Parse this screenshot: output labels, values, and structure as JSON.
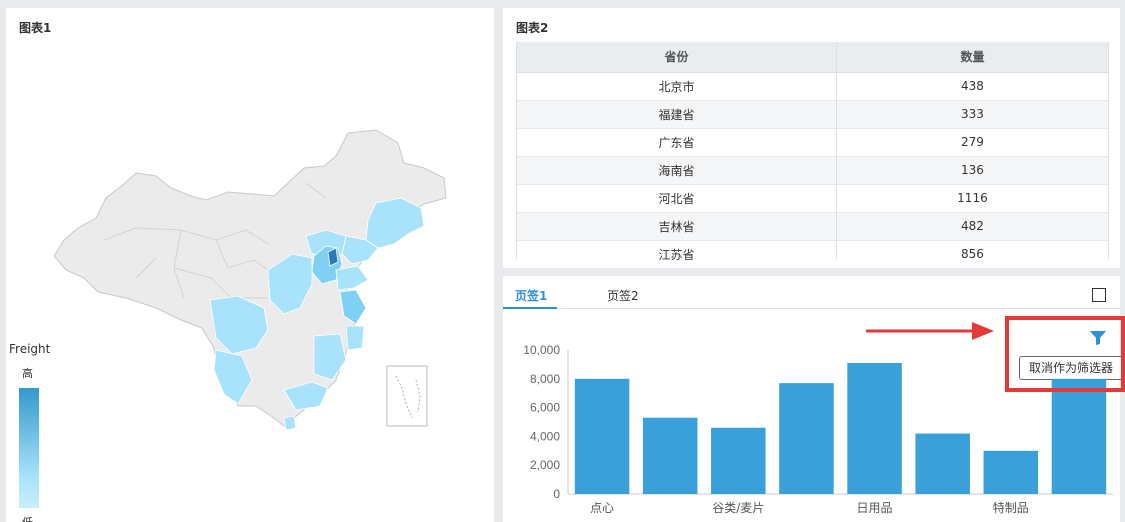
{
  "map_panel": {
    "title": "图表1",
    "legend": {
      "title": "Freight",
      "high_label": "高",
      "low_label": "低"
    },
    "colors": {
      "none": "#ebebeb",
      "light": "#a9e3fb",
      "mid": "#7fd0f2",
      "dark": "#2a78b8"
    }
  },
  "table_panel": {
    "title": "图表2",
    "columns": [
      "省份",
      "数量"
    ],
    "rows": [
      [
        "北京市",
        "438"
      ],
      [
        "福建省",
        "333"
      ],
      [
        "广东省",
        "279"
      ],
      [
        "海南省",
        "136"
      ],
      [
        "河北省",
        "1116"
      ],
      [
        "吉林省",
        "482"
      ],
      [
        "江苏省",
        "856"
      ]
    ]
  },
  "chart_panel": {
    "tabs": [
      "页签1",
      "页签2"
    ],
    "active_tab": 0,
    "filter_tooltip": "取消作为筛选器",
    "accent": "#2f8fd8",
    "bar_color": "#3aa0da",
    "highlight": "#e03a3a"
  },
  "chart_data": {
    "type": "bar",
    "categories": [
      "点心",
      "",
      "谷类/麦片",
      "",
      "日用品",
      "",
      "特制品",
      ""
    ],
    "values": [
      8000,
      5300,
      4600,
      7700,
      9100,
      4200,
      3000,
      8000
    ],
    "yticks": [
      "0",
      "2,000",
      "4,000",
      "6,000",
      "8,000",
      "10,000"
    ],
    "ylim": [
      0,
      10000
    ]
  }
}
